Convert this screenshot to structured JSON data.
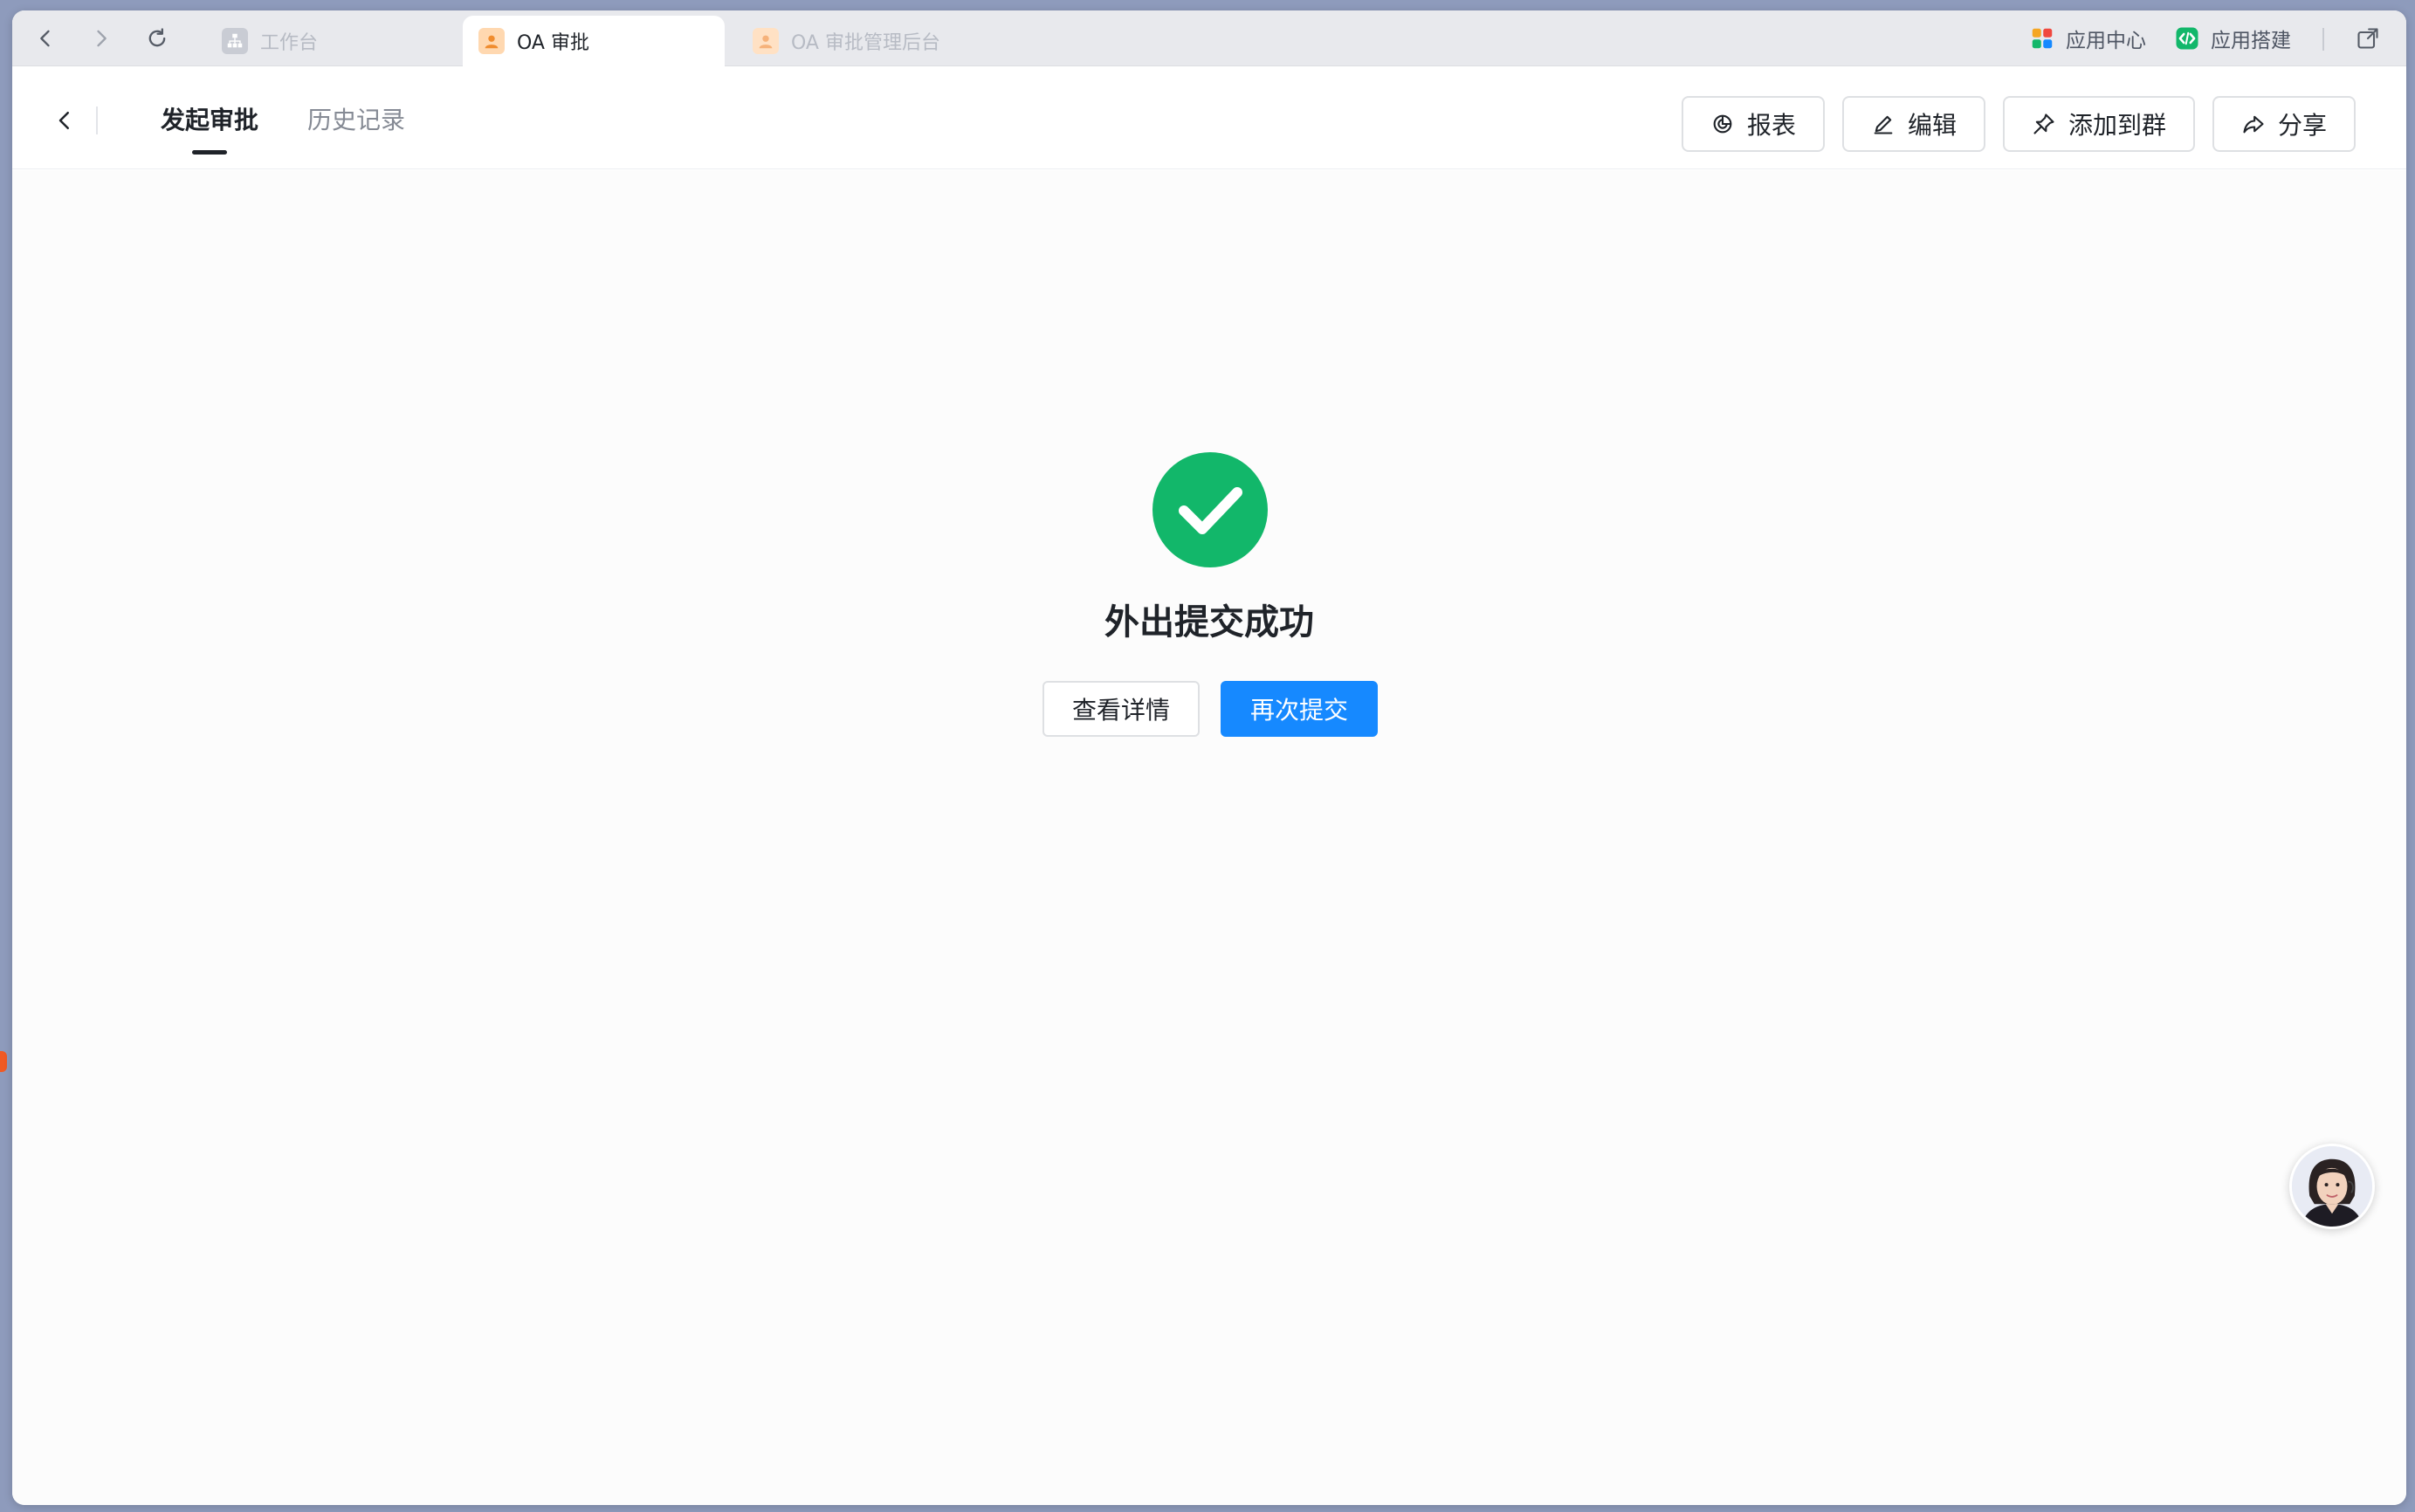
{
  "tabbar": {
    "tabs": [
      {
        "label": "工作台",
        "icon": "org-chart-icon",
        "active": false
      },
      {
        "label": "OA 审批",
        "icon": "person-icon",
        "active": true
      },
      {
        "label": "OA 审批管理后台",
        "icon": "person-icon",
        "active": false
      }
    ],
    "right": {
      "app_center": "应用中心",
      "app_builder": "应用搭建"
    }
  },
  "header": {
    "tabs": [
      {
        "label": "发起审批",
        "active": true
      },
      {
        "label": "历史记录",
        "active": false
      }
    ],
    "buttons": {
      "report": "报表",
      "edit": "编辑",
      "add_to_group": "添加到群",
      "share": "分享"
    }
  },
  "main": {
    "success_title": "外出提交成功",
    "view_details": "查看详情",
    "resubmit": "再次提交"
  },
  "colors": {
    "success": "#12b76a",
    "primary": "#1689ff",
    "text": "#1f2329"
  }
}
